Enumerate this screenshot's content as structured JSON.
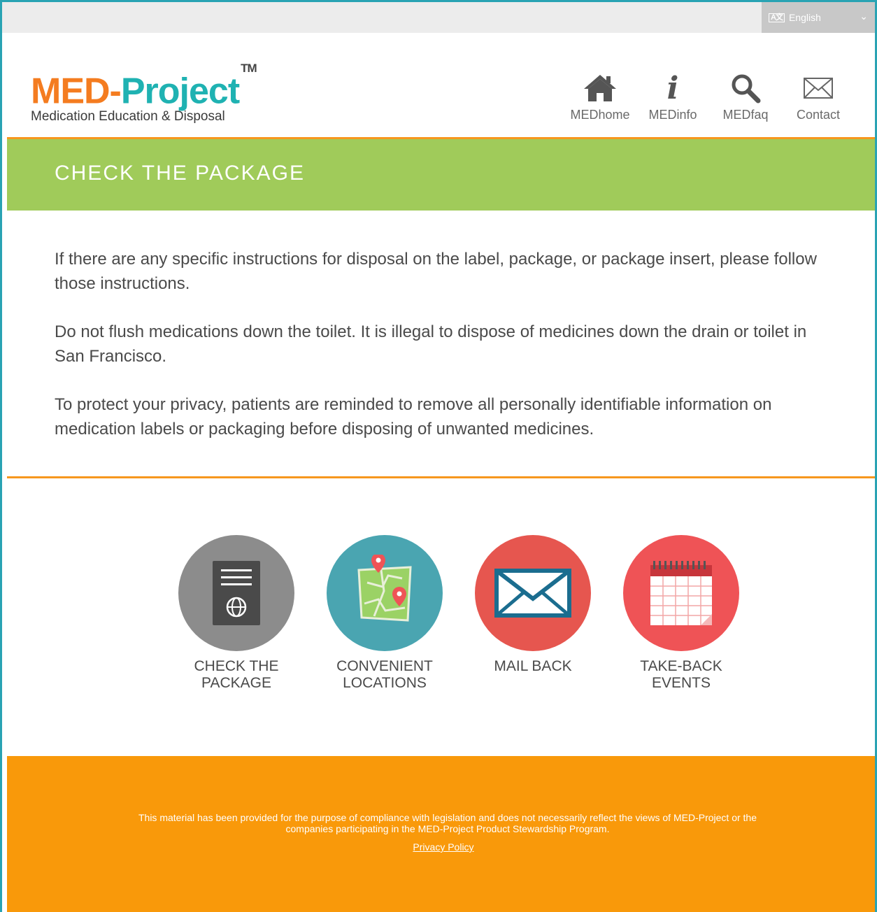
{
  "topbar": {
    "language": {
      "selected": "English",
      "icon": "translate-icon",
      "chevron": "chevron-down-icon"
    }
  },
  "header": {
    "logo": {
      "part1": "MED-",
      "part2": "Project",
      "trademark": "TM"
    },
    "tagline": "Medication Education & Disposal",
    "nav": [
      {
        "label": "MEDhome",
        "icon": "home-icon"
      },
      {
        "label": "MEDinfo",
        "icon": "info-icon"
      },
      {
        "label": "MEDfaq",
        "icon": "search-icon"
      },
      {
        "label": "Contact",
        "icon": "envelope-icon"
      }
    ]
  },
  "banner": {
    "title": "CHECK THE PACKAGE"
  },
  "content": {
    "paragraphs": [
      "If there are any specific instructions for disposal on the label, package, or package insert, please follow those instructions.",
      "Do not flush medications down the toilet. It is illegal to dispose of medicines down the drain or toilet in San Francisco.",
      "To protect your privacy, patients are reminded to remove all personally identifiable information on medication labels or packaging before disposing of unwanted medicines."
    ]
  },
  "options": [
    {
      "label": "CHECK THE PACKAGE",
      "icon": "package-insert-icon",
      "color": "#8c8c8c"
    },
    {
      "label": "CONVENIENT LOCATIONS",
      "icon": "map-icon",
      "color": "#4aa5b1"
    },
    {
      "label": "MAIL BACK",
      "icon": "mail-icon",
      "color": "#e6564f"
    },
    {
      "label": "TAKE-BACK EVENTS",
      "icon": "calendar-icon",
      "color": "#ef5356"
    }
  ],
  "footer": {
    "disclaimer": "This material has been provided for the purpose of compliance with legislation and does not necessarily reflect the views of MED-Project or the companies participating in the MED-Project Product Stewardship Program.",
    "privacy_link": "Privacy Policy"
  },
  "colors": {
    "frame": "#29a3b3",
    "logo_orange": "#f47c20",
    "logo_teal": "#1fb2b2",
    "banner_green": "#a0cb5a",
    "rule_orange": "#f7971e",
    "footer_orange": "#f9990a"
  }
}
